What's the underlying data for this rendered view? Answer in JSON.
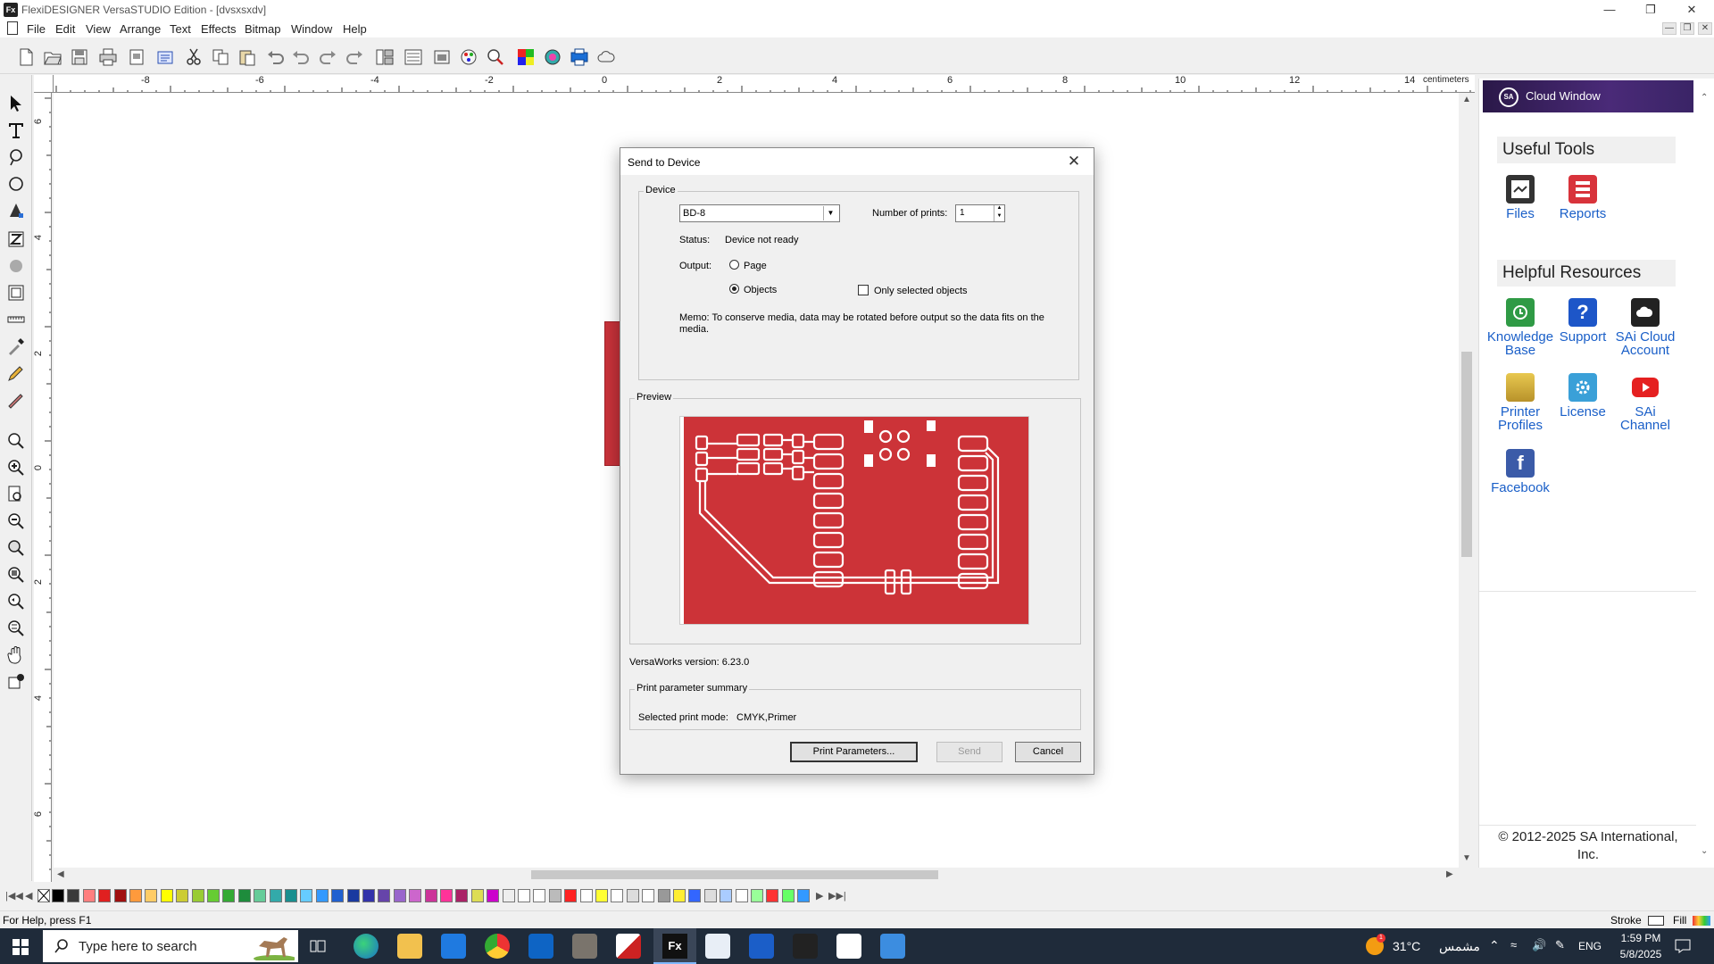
{
  "window": {
    "title": "FlexiDESIGNER VersaSTUDIO Edition - [dvsxsxdv]",
    "app_icon": "Fx",
    "controls": [
      "minimize-icon",
      "restore-icon",
      "close-icon"
    ]
  },
  "menu": [
    "File",
    "Edit",
    "View",
    "Arrange",
    "Text",
    "Effects",
    "Bitmap",
    "Window",
    "Help"
  ],
  "ruler": {
    "unit": "centimeters",
    "h_ticks": [
      "-8",
      "-6",
      "-4",
      "-2",
      "0",
      "2",
      "4",
      "6",
      "8",
      "10",
      "12",
      "14"
    ],
    "v_ticks": [
      "6",
      "4",
      "2",
      "0",
      "2",
      "4",
      "6"
    ]
  },
  "dialog": {
    "title": "Send to Device",
    "device_group": "Device",
    "device_value": "BD-8",
    "number_of_prints_label": "Number of prints:",
    "number_of_prints_value": "1",
    "status_label": "Status:",
    "status_value": "Device not ready",
    "output_label": "Output:",
    "output_page": "Page",
    "output_objects": "Objects",
    "output_selected": "objects",
    "only_selected_label": "Only selected objects",
    "only_selected_checked": false,
    "memo": "Memo: To conserve media, data may be rotated before output so the data fits on the media.",
    "preview_group": "Preview",
    "versaworks": "VersaWorks version: 6.23.0",
    "print_summary_group": "Print parameter summary",
    "print_mode_label": "Selected print mode:",
    "print_mode_value": "CMYK,Primer",
    "btn_print_params": "Print Parameters...",
    "btn_send": "Send",
    "btn_cancel": "Cancel",
    "preview_color": "#cc3338"
  },
  "cloud": {
    "header": "Cloud Window",
    "logo": "SA",
    "useful_tools_title": "Useful Tools",
    "useful_tools": [
      {
        "label": "Files",
        "icon": "files-icon"
      },
      {
        "label": "Reports",
        "icon": "reports-icon"
      }
    ],
    "helpful_title": "Helpful Resources",
    "helpful": [
      {
        "label1": "Knowledge",
        "label2": "Base",
        "icon": "knowledge-base-icon"
      },
      {
        "label1": "Support",
        "label2": "",
        "icon": "support-icon"
      },
      {
        "label1": "SAi Cloud",
        "label2": "Account",
        "icon": "cloud-account-icon"
      },
      {
        "label1": "Printer",
        "label2": "Profiles",
        "icon": "printer-profiles-icon"
      },
      {
        "label1": "License",
        "label2": "",
        "icon": "license-icon"
      },
      {
        "label1": "SAi",
        "label2": "Channel",
        "icon": "youtube-icon"
      },
      {
        "label1": "Facebook",
        "label2": "",
        "icon": "facebook-icon"
      }
    ],
    "footer_line1": "© 2012-2025 SA International,",
    "footer_line2": "Inc."
  },
  "status": {
    "help_text": "For Help, press F1",
    "stroke_label": "Stroke",
    "fill_label": "Fill"
  },
  "taskbar": {
    "search_placeholder": "Type here to search",
    "weather": "31°C",
    "weather_text": "مشمس",
    "language": "ENG",
    "time": "1:59 PM",
    "date": "5/8/2025",
    "weather_badge": "1"
  }
}
